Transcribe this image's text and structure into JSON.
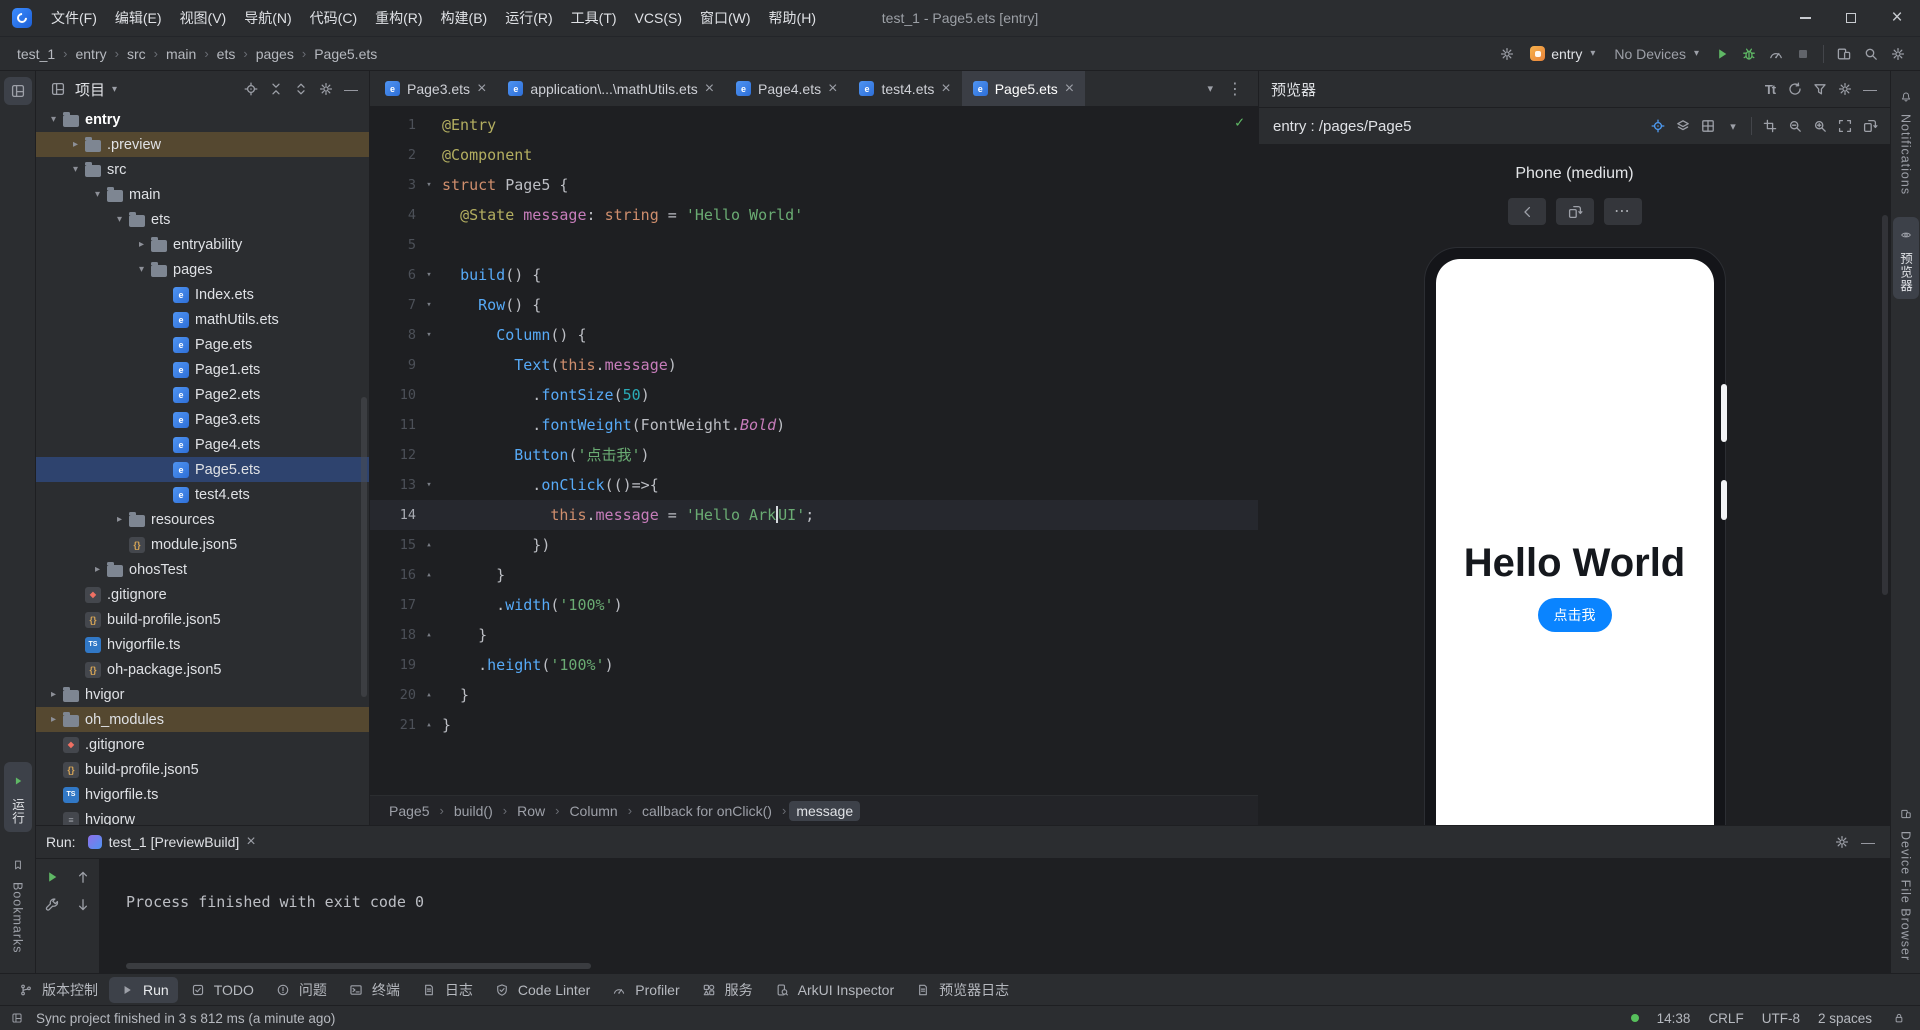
{
  "colors": {
    "accent": "#3574f0",
    "selection": "#2e436e",
    "excluded_row": "#554830",
    "run_green": "#5fb865",
    "preview_button": "#0a84ff",
    "window_bg": "#2b2d30",
    "editor_bg": "#1e1f22"
  },
  "window": {
    "title": "test_1 - Page5.ets [entry]"
  },
  "menu": {
    "items": [
      "文件(F)",
      "编辑(E)",
      "视图(V)",
      "导航(N)",
      "代码(C)",
      "重构(R)",
      "构建(B)",
      "运行(R)",
      "工具(T)",
      "VCS(S)",
      "窗口(W)",
      "帮助(H)"
    ]
  },
  "navbar": {
    "breadcrumbs": [
      "test_1",
      "entry",
      "src",
      "main",
      "ets",
      "pages",
      "Page5.ets"
    ],
    "run_config": "entry",
    "devices": "No Devices",
    "actions": [
      {
        "icon": "play",
        "name": "run-button",
        "color": "green"
      },
      {
        "icon": "bug",
        "name": "debug-button",
        "color": "green"
      },
      {
        "icon": "gauge",
        "name": "profiler-button"
      },
      {
        "icon": "stop",
        "name": "stop-button",
        "color": "disabled"
      },
      {
        "icon": "divider"
      },
      {
        "icon": "devices",
        "name": "device-manager-button"
      },
      {
        "icon": "search",
        "name": "search-everywhere-button"
      },
      {
        "icon": "gear",
        "name": "settings-button"
      }
    ]
  },
  "left_strip": {
    "run_label": "运行",
    "bookmarks_label": "Bookmarks"
  },
  "right_strip": {
    "notifications_label": "Notifications",
    "previewer_label": "预览器",
    "device_file_browser_label": "Device File Browser"
  },
  "project": {
    "header": "项目",
    "header_actions": [
      {
        "icon": "target",
        "name": "select-opened-file-button"
      },
      {
        "icon": "collapse-all",
        "name": "collapse-all-button"
      },
      {
        "icon": "expand-all",
        "name": "expand-all-button"
      },
      {
        "icon": "gear",
        "name": "panel-options-button"
      },
      {
        "icon": "minus",
        "name": "hide-panel-button"
      }
    ],
    "tree": [
      {
        "label": "entry",
        "level": 0,
        "icon": "folder",
        "chevron": "open",
        "bold": true
      },
      {
        "label": ".preview",
        "level": 1,
        "icon": "folder",
        "chevron": "closed",
        "state": "excluded"
      },
      {
        "label": "src",
        "level": 1,
        "icon": "folder",
        "chevron": "open"
      },
      {
        "label": "main",
        "level": 2,
        "icon": "folder",
        "chevron": "open"
      },
      {
        "label": "ets",
        "level": 3,
        "icon": "folder",
        "chevron": "open"
      },
      {
        "label": "entryability",
        "level": 4,
        "icon": "folder",
        "chevron": "closed"
      },
      {
        "label": "pages",
        "level": 4,
        "icon": "folder",
        "chevron": "open"
      },
      {
        "label": "Index.ets",
        "level": 5,
        "icon": "ets"
      },
      {
        "label": "mathUtils.ets",
        "level": 5,
        "icon": "ets"
      },
      {
        "label": "Page.ets",
        "level": 5,
        "icon": "ets"
      },
      {
        "label": "Page1.ets",
        "level": 5,
        "icon": "ets"
      },
      {
        "label": "Page2.ets",
        "level": 5,
        "icon": "ets"
      },
      {
        "label": "Page3.ets",
        "level": 5,
        "icon": "ets"
      },
      {
        "label": "Page4.ets",
        "level": 5,
        "icon": "ets"
      },
      {
        "label": "Page5.ets",
        "level": 5,
        "icon": "ets",
        "state": "selected"
      },
      {
        "label": "test4.ets",
        "level": 5,
        "icon": "ets"
      },
      {
        "label": "resources",
        "level": 3,
        "icon": "folder",
        "chevron": "closed"
      },
      {
        "label": "module.json5",
        "level": 3,
        "icon": "json"
      },
      {
        "label": "ohosTest",
        "level": 2,
        "icon": "folder",
        "chevron": "closed"
      },
      {
        "label": ".gitignore",
        "level": 1,
        "icon": "git"
      },
      {
        "label": "build-profile.json5",
        "level": 1,
        "icon": "json"
      },
      {
        "label": "hvigorfile.ts",
        "level": 1,
        "icon": "ts"
      },
      {
        "label": "oh-package.json5",
        "level": 1,
        "icon": "json"
      },
      {
        "label": "hvigor",
        "level": 0,
        "icon": "folder",
        "chevron": "closed"
      },
      {
        "label": "oh_modules",
        "level": 0,
        "icon": "folder",
        "chevron": "closed",
        "state": "excluded"
      },
      {
        "label": ".gitignore",
        "level": 0,
        "icon": "git"
      },
      {
        "label": "build-profile.json5",
        "level": 0,
        "icon": "json"
      },
      {
        "label": "hvigorfile.ts",
        "level": 0,
        "icon": "ts"
      },
      {
        "label": "hvigorw",
        "level": 0,
        "icon": "file"
      }
    ]
  },
  "editor": {
    "tabs": [
      {
        "label": "Page3.ets"
      },
      {
        "label": "application\\...\\mathUtils.ets"
      },
      {
        "label": "Page4.ets"
      },
      {
        "label": "test4.ets"
      },
      {
        "label": "Page5.ets",
        "active": true
      }
    ],
    "lines": [
      {
        "seg": [
          [
            "@Entry",
            "ann"
          ]
        ]
      },
      {
        "seg": [
          [
            "@Component",
            "ann"
          ]
        ]
      },
      {
        "fold": "d",
        "seg": [
          [
            "struct",
            "kw"
          ],
          [
            " Page5 {",
            "p"
          ]
        ]
      },
      {
        "seg": [
          [
            "  ",
            "p"
          ],
          [
            "@State",
            "ann"
          ],
          [
            " ",
            "p"
          ],
          [
            "message",
            "fld"
          ],
          [
            ": ",
            "p"
          ],
          [
            "string",
            "kw"
          ],
          [
            " = ",
            "p"
          ],
          [
            "'Hello World'",
            "str"
          ]
        ]
      },
      {
        "seg": []
      },
      {
        "fold": "d",
        "seg": [
          [
            "  ",
            "p"
          ],
          [
            "build",
            "fn"
          ],
          [
            "() {",
            "p"
          ]
        ]
      },
      {
        "fold": "d",
        "seg": [
          [
            "    ",
            "p"
          ],
          [
            "Row",
            "fn"
          ],
          [
            "() {",
            "p"
          ]
        ]
      },
      {
        "fold": "d",
        "seg": [
          [
            "      ",
            "p"
          ],
          [
            "Column",
            "fn"
          ],
          [
            "() {",
            "p"
          ]
        ]
      },
      {
        "seg": [
          [
            "        ",
            "p"
          ],
          [
            "Text",
            "fn"
          ],
          [
            "(",
            "p"
          ],
          [
            "this",
            "kw"
          ],
          [
            ".",
            "p"
          ],
          [
            "message",
            "fld"
          ],
          [
            ")",
            "p"
          ]
        ]
      },
      {
        "seg": [
          [
            "          .",
            "p"
          ],
          [
            "fontSize",
            "fn"
          ],
          [
            "(",
            "p"
          ],
          [
            "50",
            "num"
          ],
          [
            ")",
            "p"
          ]
        ]
      },
      {
        "seg": [
          [
            "          .",
            "p"
          ],
          [
            "fontWeight",
            "fn"
          ],
          [
            "(FontWeight.",
            "p"
          ],
          [
            "Bold",
            "fldi"
          ],
          [
            ")",
            "p"
          ]
        ]
      },
      {
        "seg": [
          [
            "        ",
            "p"
          ],
          [
            "Button",
            "fn"
          ],
          [
            "(",
            "p"
          ],
          [
            "'点击我'",
            "str"
          ],
          [
            ")",
            "p"
          ]
        ]
      },
      {
        "fold": "d",
        "seg": [
          [
            "          .",
            "p"
          ],
          [
            "onClick",
            "fn"
          ],
          [
            "(()=>{",
            "p"
          ]
        ]
      },
      {
        "active": true,
        "seg": [
          [
            "            ",
            "p"
          ],
          [
            "this",
            "kw"
          ],
          [
            ".",
            "p"
          ],
          [
            "message",
            "fld"
          ],
          [
            " = ",
            "p"
          ],
          [
            "'Hello Ark",
            "str"
          ],
          [
            "",
            "caret"
          ],
          [
            "UI'",
            "str"
          ],
          [
            ";",
            "p"
          ]
        ]
      },
      {
        "fold": "u",
        "seg": [
          [
            "          })",
            "p"
          ]
        ]
      },
      {
        "fold": "u",
        "seg": [
          [
            "      }",
            "p"
          ]
        ]
      },
      {
        "seg": [
          [
            "      .",
            "p"
          ],
          [
            "width",
            "fn"
          ],
          [
            "(",
            "p"
          ],
          [
            "'100%'",
            "str"
          ],
          [
            ")",
            "p"
          ]
        ]
      },
      {
        "fold": "u",
        "seg": [
          [
            "    }",
            "p"
          ]
        ]
      },
      {
        "seg": [
          [
            "    .",
            "p"
          ],
          [
            "height",
            "fn"
          ],
          [
            "(",
            "p"
          ],
          [
            "'100%'",
            "str"
          ],
          [
            ")",
            "p"
          ]
        ]
      },
      {
        "fold": "u",
        "seg": [
          [
            "  }",
            "p"
          ]
        ]
      },
      {
        "fold": "u",
        "seg": [
          [
            "}",
            "p"
          ]
        ]
      }
    ],
    "breadcrumbs": [
      "Page5",
      "build()",
      "Row",
      "Column",
      "callback for onClick()",
      "message"
    ]
  },
  "previewer": {
    "panel_title": "预览器",
    "target": "entry : /pages/Page5",
    "device_label": "Phone (medium)",
    "header_actions": [
      {
        "icon": "text-size",
        "name": "font-size-button"
      },
      {
        "icon": "refresh",
        "name": "refresh-preview-button"
      },
      {
        "icon": "funnel",
        "name": "filter-button"
      },
      {
        "icon": "gear",
        "name": "previewer-settings-button"
      },
      {
        "icon": "minus",
        "name": "hide-previewer-button"
      }
    ],
    "toolbar_actions": [
      {
        "icon": "target",
        "name": "component-inspect-button",
        "color": "blue"
      },
      {
        "icon": "layers",
        "name": "layers-button"
      },
      {
        "icon": "grid",
        "name": "multi-preview-button"
      },
      {
        "icon": "chevron-down",
        "name": "preview-mode-dropdown"
      },
      {
        "icon": "divider"
      },
      {
        "icon": "crop",
        "name": "frame-button"
      },
      {
        "icon": "zoom-out",
        "name": "zoom-out-button"
      },
      {
        "icon": "zoom-in",
        "name": "zoom-in-button"
      },
      {
        "icon": "fit",
        "name": "fit-to-screen-button"
      },
      {
        "icon": "rotate",
        "name": "rotate-device-button"
      }
    ],
    "ghost_buttons": [
      {
        "icon": "back",
        "name": "preview-back-button"
      },
      {
        "icon": "rotate",
        "name": "preview-orientation-button"
      },
      {
        "icon": "more",
        "name": "preview-more-button"
      }
    ],
    "screen": {
      "title": "Hello World",
      "button": "点击我"
    }
  },
  "run": {
    "label": "Run:",
    "tab": "test_1 [PreviewBuild]",
    "console": "Process finished with exit code 0",
    "gutter_actions": [
      {
        "icon": "play",
        "name": "rerun-button",
        "color": "green"
      },
      {
        "icon": "arrow-up",
        "name": "prev-occurrence-button"
      },
      {
        "icon": "wrench",
        "name": "customize-run-button"
      },
      {
        "icon": "arrow-down",
        "name": "next-occurrence-button"
      }
    ]
  },
  "bottom_bar": {
    "items": [
      {
        "label": "版本控制",
        "icon": "branch"
      },
      {
        "label": "Run",
        "icon": "play",
        "active": true
      },
      {
        "label": "TODO",
        "icon": "todo"
      },
      {
        "label": "问题",
        "icon": "problems"
      },
      {
        "label": "终端",
        "icon": "terminal"
      },
      {
        "label": "日志",
        "icon": "doc"
      },
      {
        "label": "Code Linter",
        "icon": "linter"
      },
      {
        "label": "Profiler",
        "icon": "gauge"
      },
      {
        "label": "服务",
        "icon": "services"
      },
      {
        "label": "ArkUI Inspector",
        "icon": "inspector"
      },
      {
        "label": "预览器日志",
        "icon": "doc"
      }
    ]
  },
  "status_bar": {
    "message": "Sync project finished in 3 s 812 ms (a minute ago)",
    "time": "14:38",
    "line_ending": "CRLF",
    "encoding": "UTF-8",
    "indent": "2 spaces"
  }
}
